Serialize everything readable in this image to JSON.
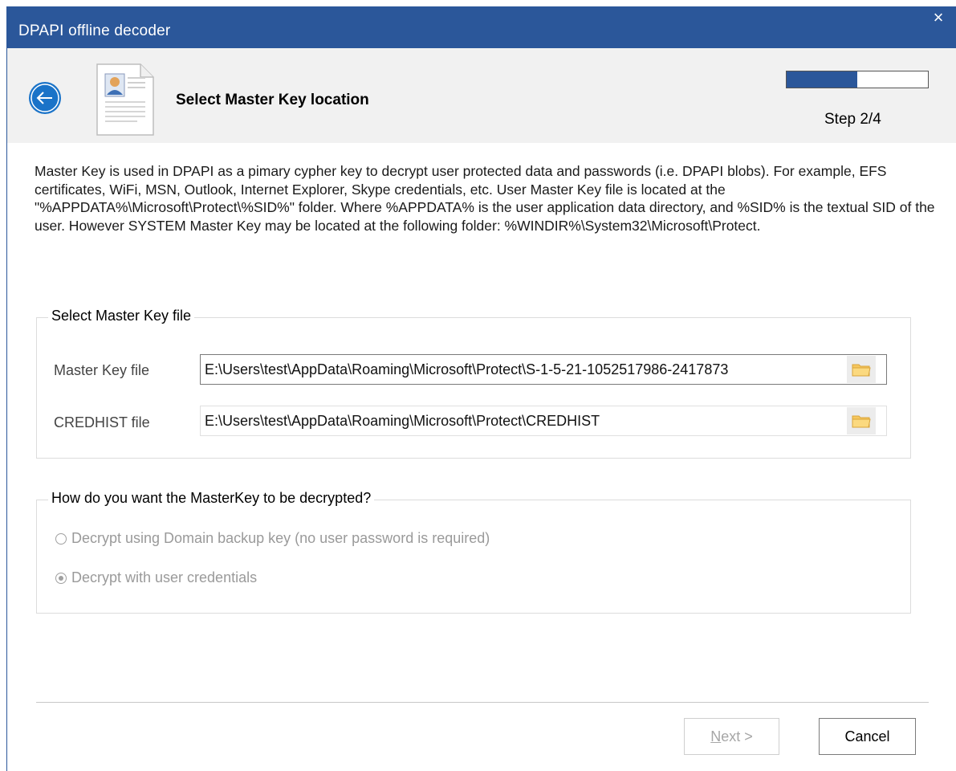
{
  "window": {
    "title": "DPAPI offline decoder",
    "close_glyph": "×"
  },
  "header": {
    "back_icon": "arrow-left-icon",
    "page_icon": "document-icon",
    "title": "Select Master Key location",
    "progress_fraction": 0.5,
    "step_label": "Step 2/4"
  },
  "description": "Master Key is used in DPAPI as a pimary cypher key to decrypt user protected data and passwords (i.e. DPAPI blobs). For example, EFS certificates, WiFi, MSN, Outlook, Internet Explorer, Skype credentials, etc. User Master Key file is located at the \"%APPDATA%\\Microsoft\\Protect\\%SID%\" folder. Where %APPDATA% is the user application data directory, and %SID% is the textual SID of the user. However SYSTEM Master Key may be located at the following folder: %WINDIR%\\System32\\Microsoft\\Protect.",
  "file_group": {
    "label": "Select Master Key file",
    "master_key": {
      "label": "Master Key file",
      "value": "E:\\Users\\test\\AppData\\Roaming\\Microsoft\\Protect\\S-1-5-21-1052517986-2417873"
    },
    "credhist": {
      "label": "CREDHIST file",
      "value": "E:\\Users\\test\\AppData\\Roaming\\Microsoft\\Protect\\CREDHIST"
    },
    "browse_icon": "folder-icon"
  },
  "decrypt_group": {
    "label": "How do you want the MasterKey to be decrypted?",
    "options": [
      {
        "label": "Decrypt using Domain backup key (no user password is required)",
        "checked": false
      },
      {
        "label": "Decrypt with user credentials",
        "checked": true
      }
    ]
  },
  "footer": {
    "next_mnemonic": "N",
    "next_rest": "ext >",
    "cancel_label": "Cancel"
  },
  "colors": {
    "titlebar": "#2b579a",
    "accent": "#1a73c8",
    "header_bg": "#f1f1f1"
  }
}
